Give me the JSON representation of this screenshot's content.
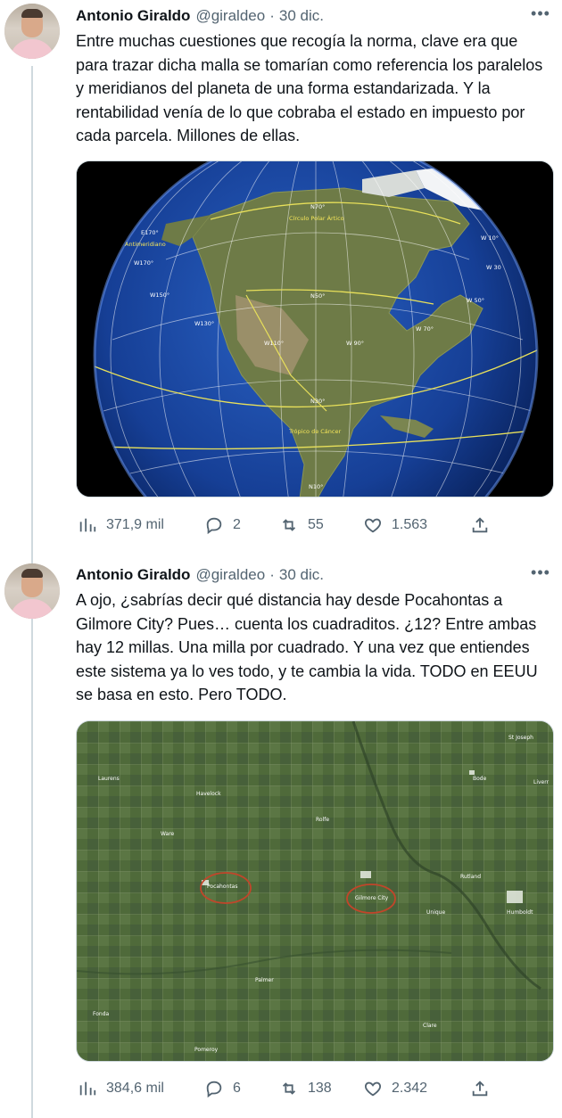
{
  "thread": {
    "tweets": [
      {
        "author_name": "Antonio Giraldo",
        "author_handle": "@giraldeo",
        "separator": "·",
        "date": "30 dic.",
        "more_label": "•••",
        "text": "Entre muchas cuestiones que recogía la norma, clave era que para trazar dicha malla se tomarían como referencia los paralelos y meridianos del planeta de una forma estandarizada. Y la rentabilidad venía de lo que cobraba el estado en impuesto por cada parcela. Millones de ellas.",
        "media": {
          "labels": {
            "n70": "N70°",
            "arctic": "Círculo Polar Ártico",
            "e170": "E170°",
            "antimeridian": "Antimeridiano",
            "w170": "W170°",
            "w150": "W150°",
            "w130": "W130°",
            "w110": "W110°",
            "n50": "N50°",
            "w90": "W 90°",
            "w70": "W 70°",
            "w50": "W 50°",
            "w30": "W 30",
            "w10": "W 10°",
            "n30": "N30°",
            "cancer": "Trópico de Cáncer",
            "n10": "N10°"
          }
        },
        "stats": {
          "views": "371,9 mil",
          "replies": "2",
          "retweets": "55",
          "likes": "1.563"
        }
      },
      {
        "author_name": "Antonio Giraldo",
        "author_handle": "@giraldeo",
        "separator": "·",
        "date": "30 dic.",
        "more_label": "•••",
        "text": "A ojo, ¿sabrías decir qué distancia hay desde Pocahontas a Gilmore City? Pues… cuenta los cuadraditos. ¿12? Entre ambas hay 12 millas. Una milla por cuadrado. Y una vez que entiendes este sistema ya lo ves todo, y te cambia la vida. TODO en EEUU se basa en esto. Pero TODO.",
        "media": {
          "labels": {
            "st_joseph": "St Joseph",
            "laurens": "Laurens",
            "bode": "Bode",
            "livermore": "Liverr",
            "havelock": "Havelock",
            "rolfe": "Rolfe",
            "ware": "Ware",
            "rutland": "Rutland",
            "pocahontas": "Pocahontas",
            "gilmore_city": "Gilmore City",
            "humboldt": "Humboldt",
            "unique": "Unique",
            "palmer": "Palmer",
            "fonda": "Fonda",
            "clare": "Clare",
            "pomeroy": "Pomeroy"
          }
        },
        "stats": {
          "views": "384,6 mil",
          "replies": "6",
          "retweets": "138",
          "likes": "2.342"
        }
      }
    ]
  },
  "colors": {
    "text": "#0f1419",
    "secondary": "#536471",
    "thread_line": "#cfd9de",
    "ocean": "#123a8c",
    "land": "#6f7d4a",
    "grid_yellow": "#e8e05a",
    "field_green": "#4f6a3a"
  }
}
